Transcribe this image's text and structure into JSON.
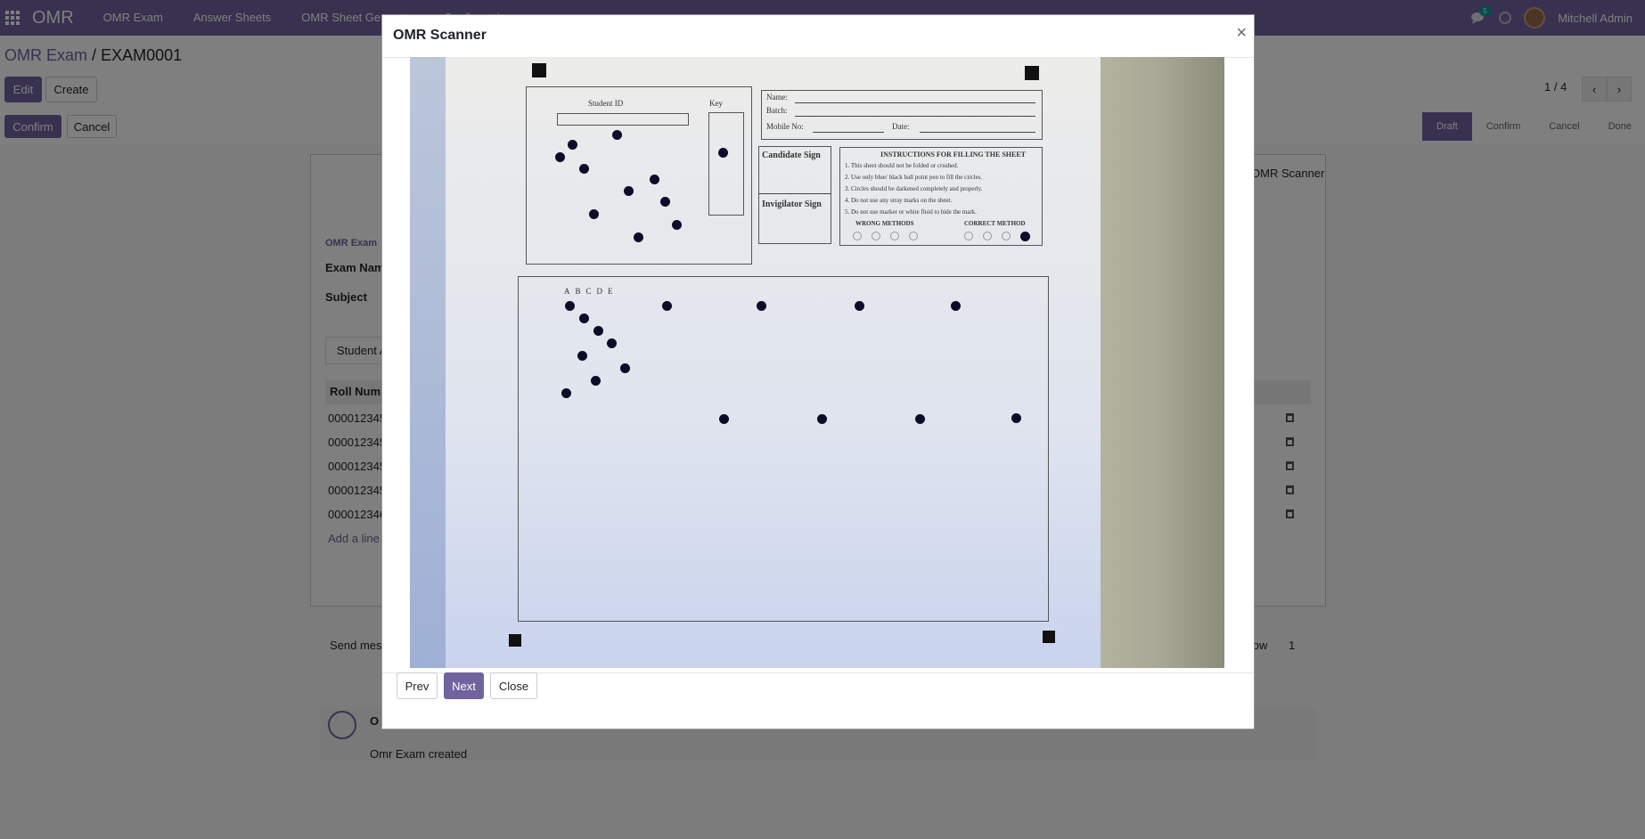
{
  "navbar": {
    "brand": "OMR",
    "menu": [
      "OMR Exam",
      "Answer Sheets",
      "OMR Sheet Generate",
      "Configuration"
    ],
    "chat_count": "5",
    "user_name": "Mitchell Admin"
  },
  "control_panel": {
    "breadcrumb_parent": "OMR Exam",
    "breadcrumb_sep": "/",
    "breadcrumb_current": "EXAM0001",
    "edit_label": "Edit",
    "create_label": "Create",
    "confirm_label": "Confirm",
    "cancel_label": "Cancel",
    "pager": "1 / 4",
    "statuses": [
      "Draft",
      "Confirm",
      "Cancel",
      "Done"
    ]
  },
  "form": {
    "scanner_button": "OMR Scanner",
    "section_label": "OMR Exam",
    "exam_name_label": "Exam Name",
    "subject_label": "Subject",
    "tab_label": "Student A",
    "column_roll": "Roll Numb",
    "rows": [
      "000012345",
      "000012345",
      "000012345",
      "000012345",
      "000012346"
    ],
    "add_line": "Add a line"
  },
  "chatter": {
    "send_message": "Send mes",
    "follow": "llow",
    "followers": "1",
    "author": "O",
    "message": "Omr Exam created"
  },
  "modal": {
    "title": "OMR Scanner",
    "close_symbol": "×",
    "prev_label": "Prev",
    "next_label": "Next",
    "close_label": "Close"
  },
  "sheet": {
    "student_id": "Student ID",
    "key": "Key",
    "name": "Name:",
    "batch": "Batch:",
    "mobile": "Mobile No:",
    "date": "Date:",
    "candidate_sign": "Candidate Sign",
    "invigilator_sign": "Invigilator Sign",
    "instructions_title": "INSTRUCTIONS FOR FILLING THE SHEET",
    "instructions": [
      "1. This sheet should not be folded or crushed.",
      "2. Use only blue/ black ball point pen to fill the circles.",
      "3. Circles should be darkened completely and properly.",
      "4. Do not use any stray marks on the sheet.",
      "5. Do not use marker or white fluid to hide the mark."
    ],
    "wrong_methods": "WRONG METHODS",
    "correct_method": "CORRECT METHOD",
    "choices": [
      "A",
      "B",
      "C",
      "D",
      "E"
    ]
  }
}
